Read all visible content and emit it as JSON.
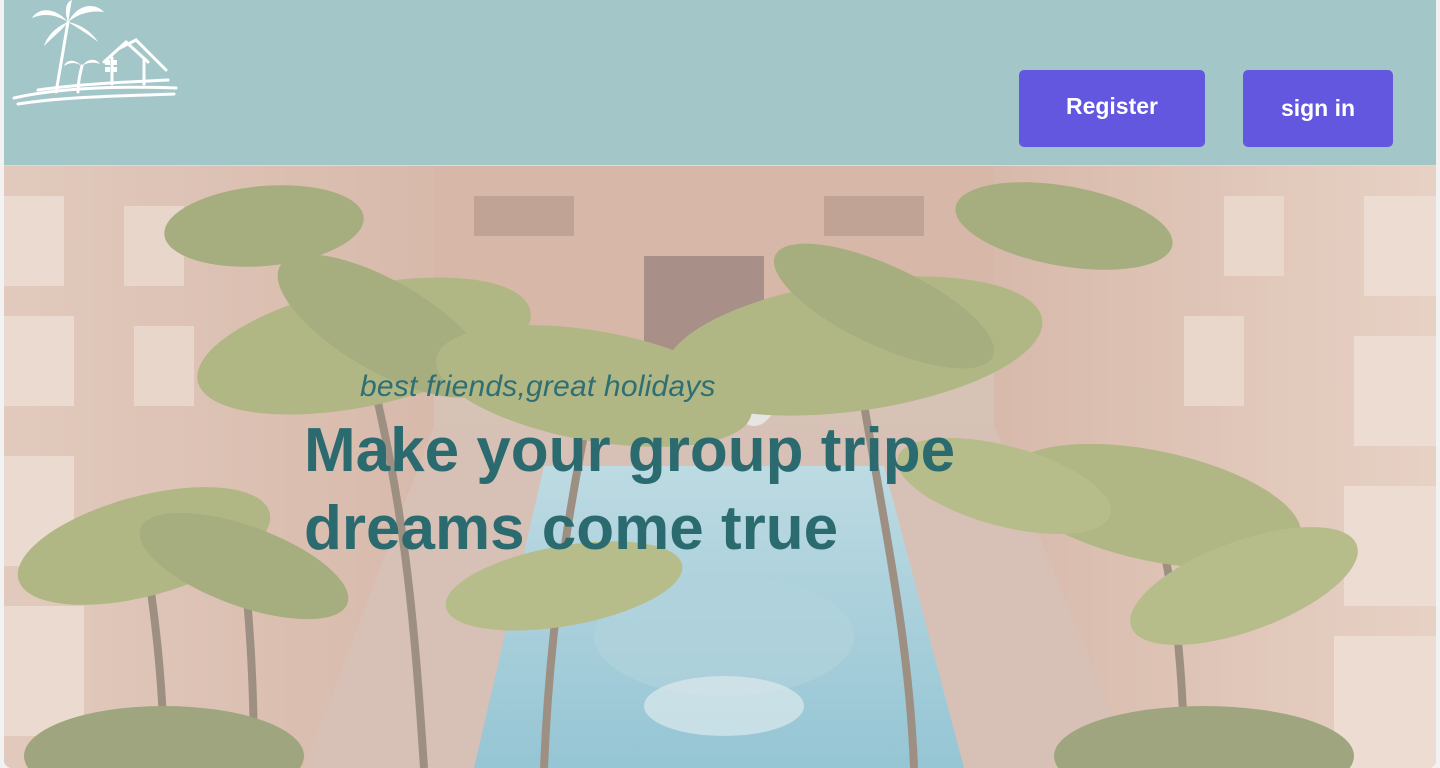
{
  "header": {
    "logo_name": "palm-house-logo",
    "register_label": "Register",
    "signin_label": "sign in"
  },
  "hero": {
    "tagline": "best friends,great holidays",
    "headline": "Make your group tripe dreams come true"
  },
  "colors": {
    "header_bg": "#a3c6c8",
    "button_bg": "#6356df",
    "button_text": "#ffffff",
    "hero_text": "#2b6a6f"
  }
}
